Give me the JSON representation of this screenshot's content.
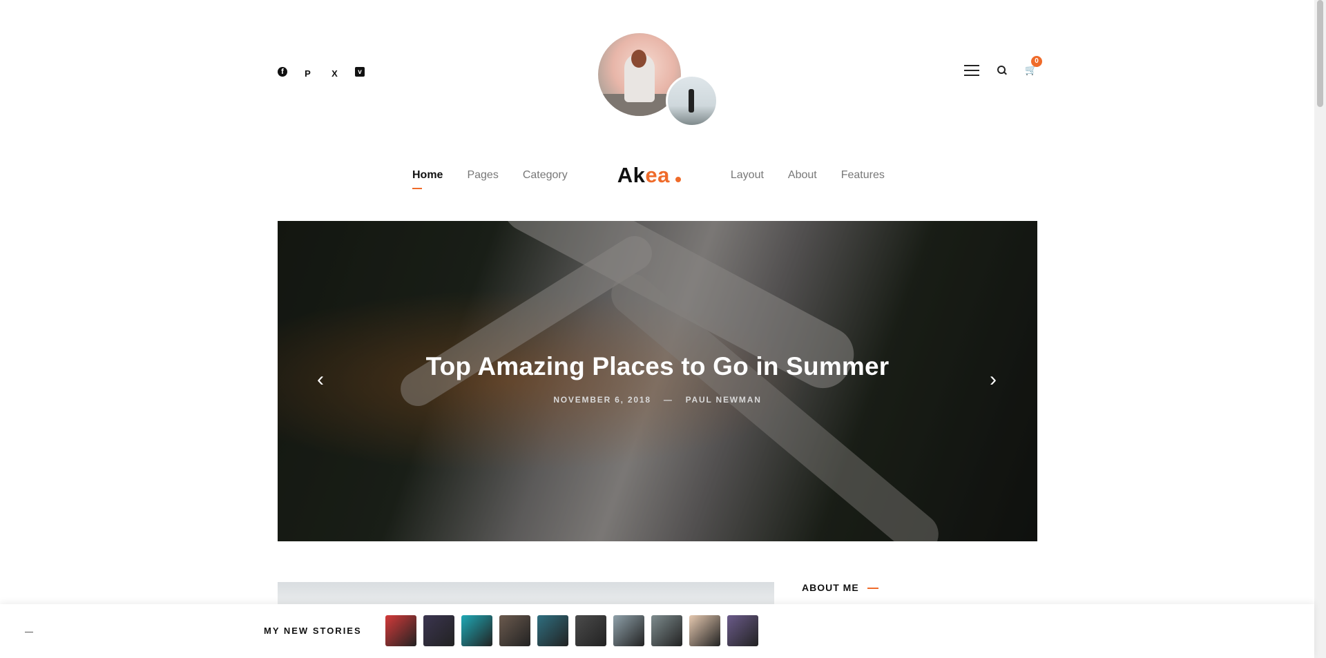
{
  "header": {
    "social": [
      {
        "icon": "facebook-icon",
        "glyph": "f"
      },
      {
        "icon": "pinterest-icon",
        "glyph": "P"
      },
      {
        "icon": "x-icon",
        "glyph": "X"
      },
      {
        "icon": "vimeo-icon",
        "glyph": "v"
      }
    ],
    "cart_count": "0"
  },
  "nav": {
    "left": [
      "Home",
      "Pages",
      "Category"
    ],
    "logo_main": "Ak",
    "logo_accent": "ea",
    "right": [
      "Layout",
      "About",
      "Features"
    ],
    "active": "Home"
  },
  "slider": {
    "title": "Top Amazing Places to Go in Summer",
    "date": "NOVEMBER 6, 2018",
    "separator": "—",
    "author": "PAUL NEWMAN",
    "prev_icon": "‹",
    "next_icon": "›"
  },
  "sidebar": {
    "about_title": "ABOUT ME"
  },
  "stories": {
    "label": "MY NEW STORIES",
    "thumbs": [
      {
        "color": "#d43a3a"
      },
      {
        "color": "#3b3550"
      },
      {
        "color": "#1fa9b6"
      },
      {
        "color": "#6b5a4e"
      },
      {
        "color": "#2f6f80"
      },
      {
        "color": "#4b4b4b"
      },
      {
        "color": "#8fa1aa"
      },
      {
        "color": "#7e8c8e"
      },
      {
        "color": "#e6c9b0"
      },
      {
        "color": "#6b5b8a"
      }
    ]
  },
  "colors": {
    "accent": "#ef6b2a"
  }
}
